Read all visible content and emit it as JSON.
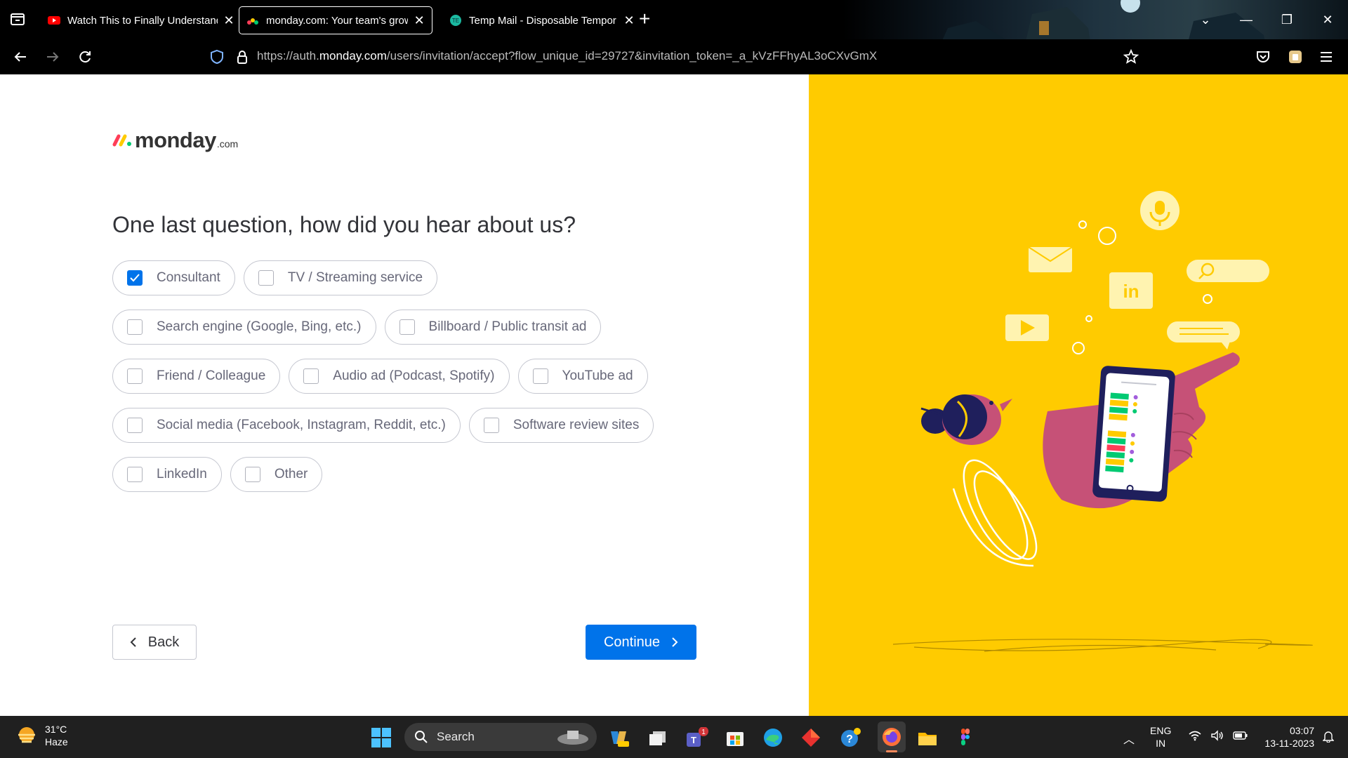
{
  "browser": {
    "tabs": [
      {
        "title": "Watch This to Finally Understand",
        "favicon": "youtube-icon",
        "active": false
      },
      {
        "title": "monday.com: Your team's growth",
        "favicon": "monday-icon",
        "active": true
      },
      {
        "title": "Temp Mail - Disposable Tempor",
        "favicon": "tempmail-icon",
        "active": false
      }
    ],
    "url_prefix": "https://auth.",
    "url_domain": "monday.com",
    "url_rest": "/users/invitation/accept?flow_unique_id=29727&invitation_token=_a_kVzFFhyAL3oCXvGmX"
  },
  "page": {
    "logo_text": "monday",
    "logo_suffix": ".com",
    "question": "One last question, how did you hear about us?",
    "option_rows": [
      [
        {
          "label": "Consultant",
          "checked": true
        },
        {
          "label": "TV / Streaming service",
          "checked": false
        }
      ],
      [
        {
          "label": "Search engine (Google, Bing, etc.)",
          "checked": false
        },
        {
          "label": "Billboard / Public transit ad",
          "checked": false
        }
      ],
      [
        {
          "label": "Friend / Colleague",
          "checked": false
        },
        {
          "label": "Audio ad (Podcast, Spotify)",
          "checked": false
        },
        {
          "label": "YouTube ad",
          "checked": false
        }
      ],
      [
        {
          "label": "Social media (Facebook, Instagram, Reddit, etc.)",
          "checked": false
        },
        {
          "label": "Software review sites",
          "checked": false
        }
      ],
      [
        {
          "label": "LinkedIn",
          "checked": false
        },
        {
          "label": "Other",
          "checked": false
        }
      ]
    ],
    "back_label": "Back",
    "continue_label": "Continue",
    "accent_color": "#0073ea",
    "illustration_bg": "#ffcb00"
  },
  "taskbar": {
    "temperature": "31°C",
    "condition": "Haze",
    "search_placeholder": "Search",
    "teams_badge": "1",
    "lang_top": "ENG",
    "lang_bottom": "IN",
    "time": "03:07",
    "date": "13-11-2023"
  }
}
